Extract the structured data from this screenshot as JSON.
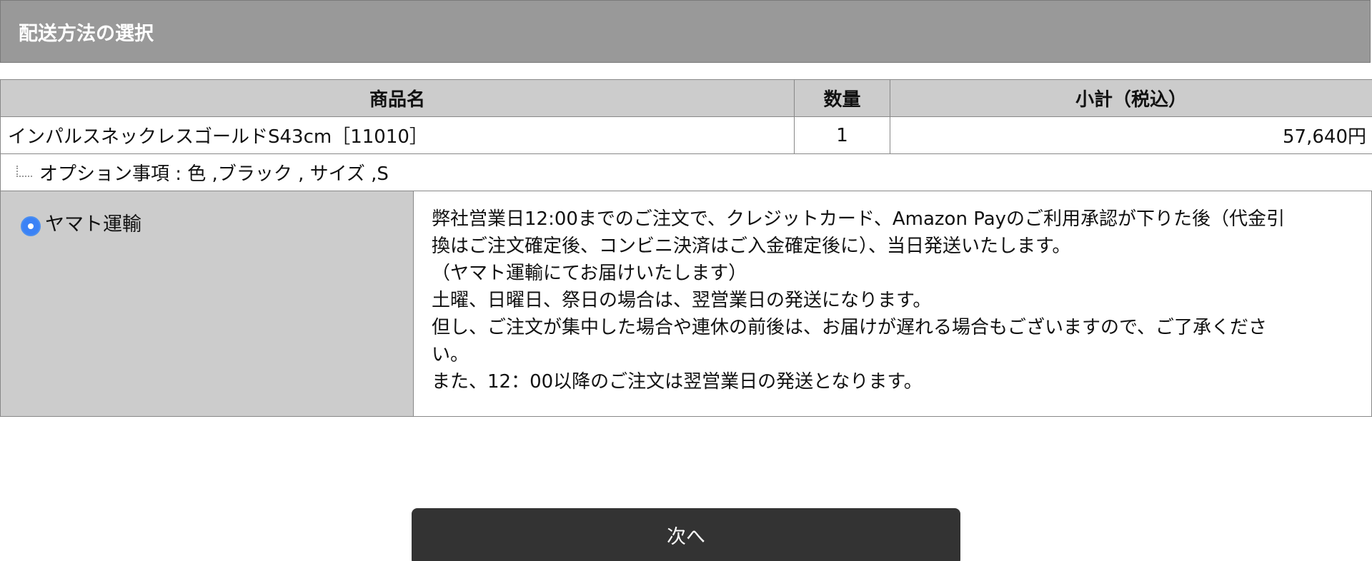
{
  "header": {
    "title": "配送方法の選択"
  },
  "table": {
    "columns": [
      "商品名",
      "数量",
      "小計（税込）"
    ],
    "row": {
      "name": "インパルスネックレスゴールドS43cm［11010］",
      "qty": "1",
      "subtotal": "57,640円"
    },
    "option": "オプション事項 : 色 ,ブラック , サイズ ,S"
  },
  "shipping": {
    "method_label": "ヤマト運輸",
    "selected": true,
    "description_lines": [
      "弊社営業日12:00までのご注文で、クレジットカード、Amazon Payのご利用承認が下りた後（代金引",
      "換はご注文確定後、コンビニ決済はご入金確定後に）、当日発送いたします。",
      "（ヤマト運輸にてお届けいたします）",
      "土曜、日曜日、祭日の場合は、翌営業日の発送になります。",
      "但し、ご注文が集中した場合や連休の前後は、お届けが遅れる場合もございますので、ご了承くださ",
      "い。",
      "また、12：00以降のご注文は翌営業日の発送となります。"
    ]
  },
  "actions": {
    "next_label": "次へ"
  },
  "colors": {
    "header_bg": "#999999",
    "table_header_bg": "#cccccc",
    "radio_accent": "#3b82f6",
    "button_bg": "#333333"
  }
}
